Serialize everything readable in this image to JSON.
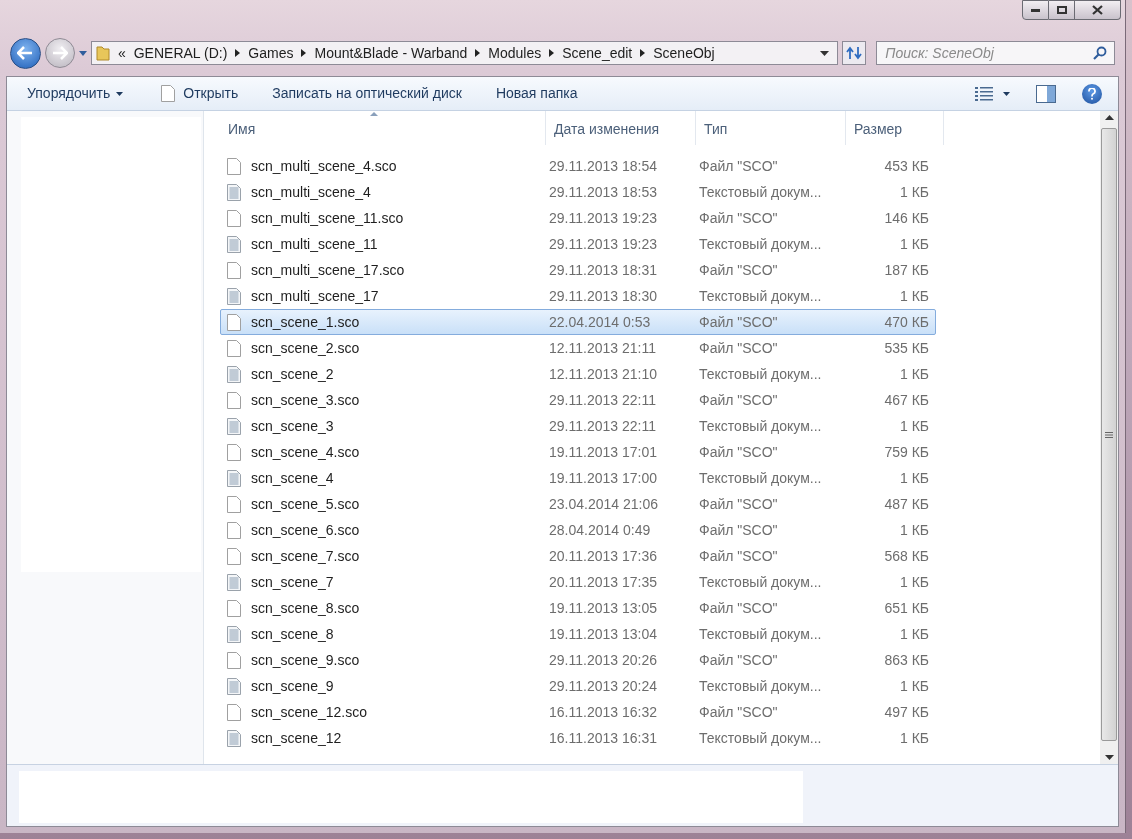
{
  "address": {
    "overflow": "«",
    "crumbs": [
      "GENERAL (D:)",
      "Games",
      "Mount&Blade - Warband",
      "Modules",
      "Scene_edit",
      "SceneObj"
    ]
  },
  "search": {
    "placeholder": "Поиск: SceneObj"
  },
  "toolbar": {
    "organize": "Упорядочить",
    "buttons": [
      "Открыть",
      "Записать на оптический диск",
      "Новая папка"
    ]
  },
  "columns": [
    "Имя",
    "Дата изменения",
    "Тип",
    "Размер"
  ],
  "rows": [
    {
      "kind": "sco",
      "name": "scn_multi_scene_4.sco",
      "date": "29.11.2013 18:54",
      "type": "Файл \"SCO\"",
      "size": "453 КБ",
      "selected": false
    },
    {
      "kind": "text",
      "name": "scn_multi_scene_4",
      "date": "29.11.2013 18:53",
      "type": "Текстовый докум...",
      "size": "1 КБ",
      "selected": false
    },
    {
      "kind": "sco",
      "name": "scn_multi_scene_11.sco",
      "date": "29.11.2013 19:23",
      "type": "Файл \"SCO\"",
      "size": "146 КБ",
      "selected": false
    },
    {
      "kind": "text",
      "name": "scn_multi_scene_11",
      "date": "29.11.2013 19:23",
      "type": "Текстовый докум...",
      "size": "1 КБ",
      "selected": false
    },
    {
      "kind": "sco",
      "name": "scn_multi_scene_17.sco",
      "date": "29.11.2013 18:31",
      "type": "Файл \"SCO\"",
      "size": "187 КБ",
      "selected": false
    },
    {
      "kind": "text",
      "name": "scn_multi_scene_17",
      "date": "29.11.2013 18:30",
      "type": "Текстовый докум...",
      "size": "1 КБ",
      "selected": false
    },
    {
      "kind": "sco",
      "name": "scn_scene_1.sco",
      "date": "22.04.2014 0:53",
      "type": "Файл \"SCO\"",
      "size": "470 КБ",
      "selected": true
    },
    {
      "kind": "sco",
      "name": "scn_scene_2.sco",
      "date": "12.11.2013 21:11",
      "type": "Файл \"SCO\"",
      "size": "535 КБ",
      "selected": false
    },
    {
      "kind": "text",
      "name": "scn_scene_2",
      "date": "12.11.2013 21:10",
      "type": "Текстовый докум...",
      "size": "1 КБ",
      "selected": false
    },
    {
      "kind": "sco",
      "name": "scn_scene_3.sco",
      "date": "29.11.2013 22:11",
      "type": "Файл \"SCO\"",
      "size": "467 КБ",
      "selected": false
    },
    {
      "kind": "text",
      "name": "scn_scene_3",
      "date": "29.11.2013 22:11",
      "type": "Текстовый докум...",
      "size": "1 КБ",
      "selected": false
    },
    {
      "kind": "sco",
      "name": "scn_scene_4.sco",
      "date": "19.11.2013 17:01",
      "type": "Файл \"SCO\"",
      "size": "759 КБ",
      "selected": false
    },
    {
      "kind": "text",
      "name": "scn_scene_4",
      "date": "19.11.2013 17:00",
      "type": "Текстовый докум...",
      "size": "1 КБ",
      "selected": false
    },
    {
      "kind": "sco",
      "name": "scn_scene_5.sco",
      "date": "23.04.2014 21:06",
      "type": "Файл \"SCO\"",
      "size": "487 КБ",
      "selected": false
    },
    {
      "kind": "sco",
      "name": "scn_scene_6.sco",
      "date": "28.04.2014 0:49",
      "type": "Файл \"SCO\"",
      "size": "1 КБ",
      "selected": false
    },
    {
      "kind": "sco",
      "name": "scn_scene_7.sco",
      "date": "20.11.2013 17:36",
      "type": "Файл \"SCO\"",
      "size": "568 КБ",
      "selected": false
    },
    {
      "kind": "text",
      "name": "scn_scene_7",
      "date": "20.11.2013 17:35",
      "type": "Текстовый докум...",
      "size": "1 КБ",
      "selected": false
    },
    {
      "kind": "sco",
      "name": "scn_scene_8.sco",
      "date": "19.11.2013 13:05",
      "type": "Файл \"SCO\"",
      "size": "651 КБ",
      "selected": false
    },
    {
      "kind": "text",
      "name": "scn_scene_8",
      "date": "19.11.2013 13:04",
      "type": "Текстовый докум...",
      "size": "1 КБ",
      "selected": false
    },
    {
      "kind": "sco",
      "name": "scn_scene_9.sco",
      "date": "29.11.2013 20:26",
      "type": "Файл \"SCO\"",
      "size": "863 КБ",
      "selected": false
    },
    {
      "kind": "text",
      "name": "scn_scene_9",
      "date": "29.11.2013 20:24",
      "type": "Текстовый докум...",
      "size": "1 КБ",
      "selected": false
    },
    {
      "kind": "sco",
      "name": "scn_scene_12.sco",
      "date": "16.11.2013 16:32",
      "type": "Файл \"SCO\"",
      "size": "497 КБ",
      "selected": false
    },
    {
      "kind": "text",
      "name": "scn_scene_12",
      "date": "16.11.2013 16:31",
      "type": "Текстовый докум...",
      "size": "1 КБ",
      "selected": false
    }
  ]
}
